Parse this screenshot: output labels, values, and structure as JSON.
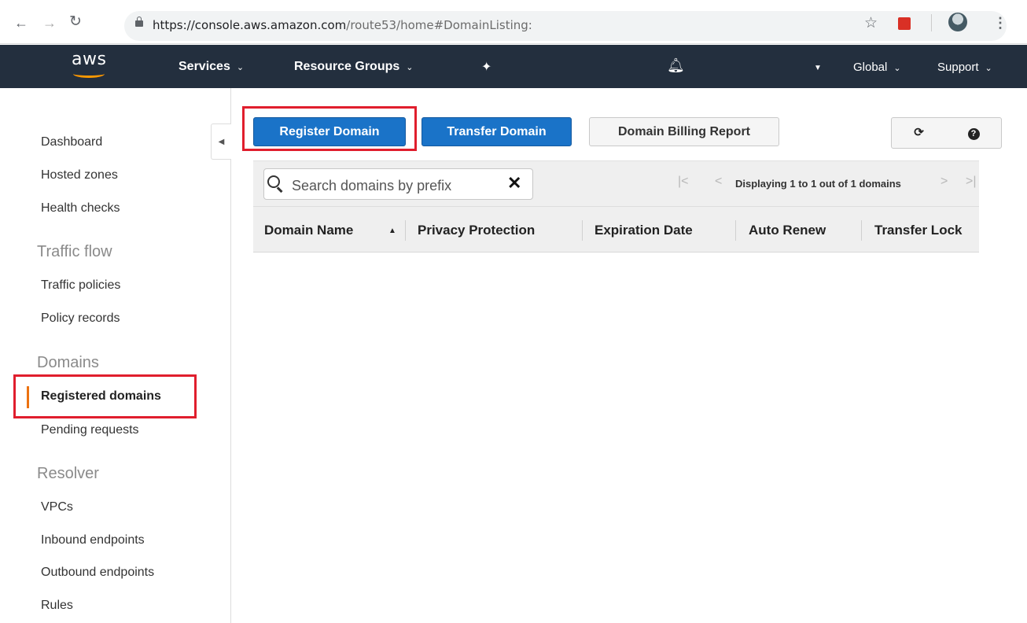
{
  "browser": {
    "url_host": "https://console.aws.amazon.com",
    "url_path": "/route53/home#DomainListing:"
  },
  "aws_nav": {
    "logo_text": "aws",
    "services": "Services",
    "resource_groups": "Resource Groups",
    "region": "Global",
    "support": "Support"
  },
  "sidebar": {
    "items": [
      "Dashboard",
      "Hosted zones",
      "Health checks"
    ],
    "traffic_flow": {
      "heading": "Traffic flow",
      "items": [
        "Traffic policies",
        "Policy records"
      ]
    },
    "domains": {
      "heading": "Domains",
      "items": [
        "Registered domains",
        "Pending requests"
      ]
    },
    "resolver": {
      "heading": "Resolver",
      "items": [
        "VPCs",
        "Inbound endpoints",
        "Outbound endpoints",
        "Rules"
      ]
    }
  },
  "toolbar": {
    "register": "Register Domain",
    "transfer": "Transfer Domain",
    "billing": "Domain Billing Report"
  },
  "grid": {
    "search_placeholder": "Search domains by prefix",
    "pager_text": "Displaying 1 to 1 out of 1 domains",
    "columns": [
      "Domain Name",
      "Privacy Protection",
      "Expiration Date",
      "Auto Renew",
      "Transfer Lock"
    ]
  },
  "colors": {
    "aws_nav_bg": "#232f3e",
    "primary_button": "#1a73c8",
    "highlight_box": "#e01e2d",
    "active_indicator": "#ec7211"
  }
}
